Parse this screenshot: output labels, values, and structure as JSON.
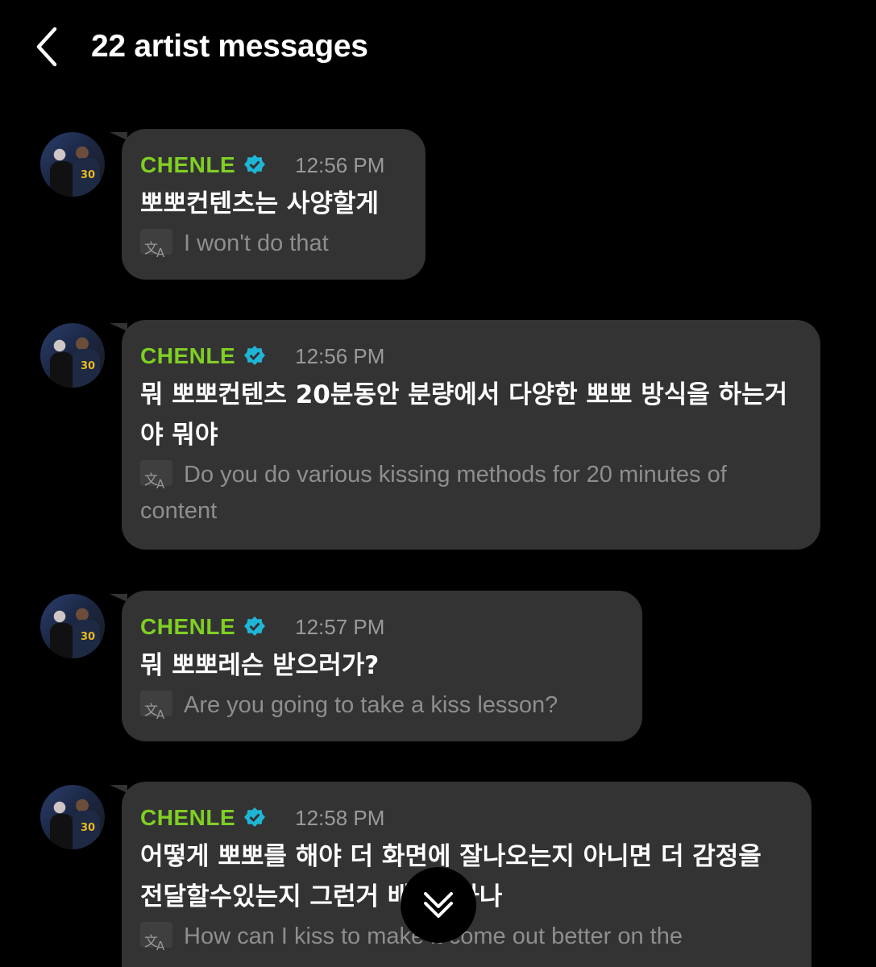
{
  "header": {
    "title": "22 artist messages"
  },
  "messages": [
    {
      "name": "CHENLE",
      "time": "12:56 PM",
      "text": "뽀뽀컨텐츠는 사양할게",
      "translation": "I won't do that"
    },
    {
      "name": "CHENLE",
      "time": "12:56 PM",
      "text": "뭐 뽀뽀컨텐츠 20분동안 분량에서 다양한 뽀뽀 방식을 하는거야 뭐야",
      "translation": "Do you do various kissing methods for 20 minutes of content"
    },
    {
      "name": "CHENLE",
      "time": "12:57 PM",
      "text": "뭐 뽀뽀레슨 받으러가?",
      "translation": "Are you going to take a kiss lesson?"
    },
    {
      "name": "CHENLE",
      "time": "12:58 PM",
      "text": "어떻게 뽀뽀를 해야 더 화면에 잘나오는지 아니면 더 감정을 전달할수있는지 그런거 배우러가나",
      "translation": "How can I kiss to make it come out better on the"
    }
  ],
  "colors": {
    "background": "#000000",
    "bubble": "#333333",
    "name": "#7fcf24",
    "verified": "#1fb6d6",
    "time": "#9a9a9a",
    "translation": "#8e8e8e"
  },
  "icons": {
    "back": "chevron-left-icon",
    "verified": "verified-badge-icon",
    "translate": "translate-icon",
    "scroll": "double-chevron-down-icon"
  }
}
